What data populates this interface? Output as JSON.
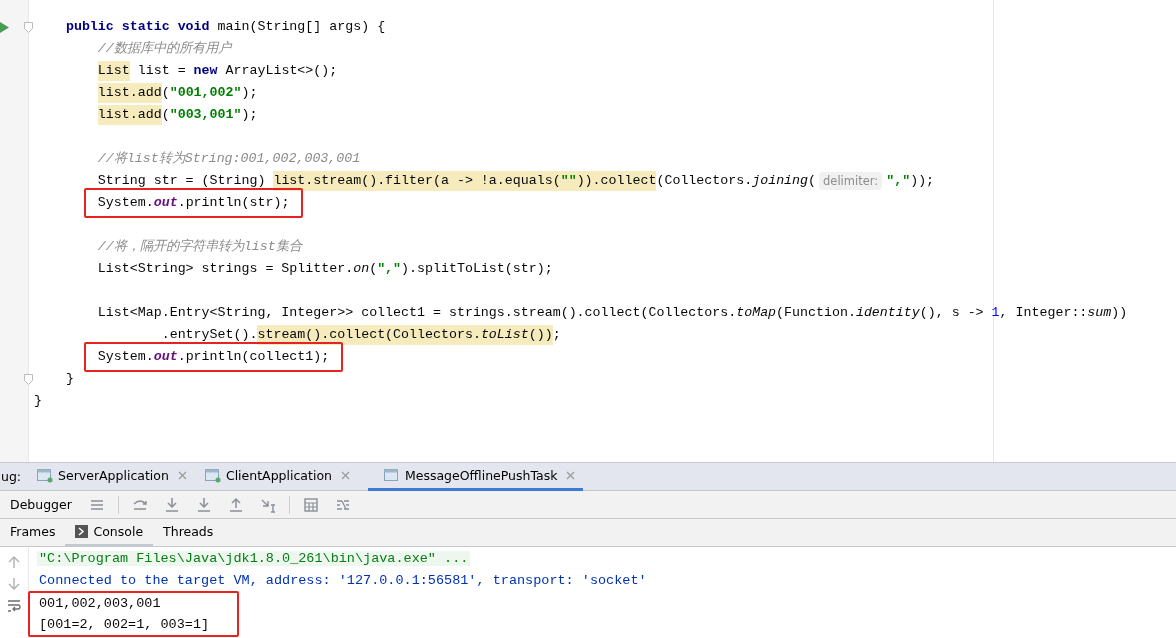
{
  "editor": {
    "lines": [
      {
        "boxed": false,
        "run_marker": true,
        "fold": true,
        "tokens": [
          {
            "text": "    public static void",
            "kind": "keyword",
            "hl": false
          },
          {
            "text": " main(String[] args) {",
            "kind": "plain",
            "hl": false
          }
        ]
      },
      {
        "boxed": false,
        "run_marker": false,
        "fold": false,
        "tokens": [
          {
            "text": "        //数据库中的所有用户",
            "kind": "comment",
            "hl": false
          }
        ]
      },
      {
        "boxed": false,
        "run_marker": false,
        "fold": false,
        "tokens": [
          {
            "text": "        List",
            "kind": "plain",
            "hl": true
          },
          {
            "text": " list = ",
            "kind": "plain",
            "hl": false
          },
          {
            "text": "new",
            "kind": "keyword",
            "hl": false
          },
          {
            "text": " ArrayList<>();",
            "kind": "plain",
            "hl": false
          }
        ]
      },
      {
        "boxed": false,
        "run_marker": false,
        "fold": false,
        "tokens": [
          {
            "text": "        list.add",
            "kind": "plain",
            "hl": true
          },
          {
            "text": "(",
            "kind": "plain",
            "hl": false
          },
          {
            "text": "\"001,002\"",
            "kind": "string",
            "hl": false
          },
          {
            "text": ");",
            "kind": "plain",
            "hl": false
          }
        ]
      },
      {
        "boxed": false,
        "run_marker": false,
        "fold": false,
        "tokens": [
          {
            "text": "        list.add",
            "kind": "plain",
            "hl": true
          },
          {
            "text": "(",
            "kind": "plain",
            "hl": false
          },
          {
            "text": "\"003,001\"",
            "kind": "string",
            "hl": false
          },
          {
            "text": ");",
            "kind": "plain",
            "hl": false
          }
        ]
      },
      {
        "boxed": false,
        "run_marker": false,
        "fold": false
      },
      {
        "boxed": false,
        "run_marker": false,
        "fold": false,
        "tokens": [
          {
            "text": "        //将list转为String:001,002,003,001",
            "kind": "comment",
            "hl": false
          }
        ]
      },
      {
        "boxed": false,
        "run_marker": false,
        "fold": false,
        "tokens": [
          {
            "text": "        String str = (String) ",
            "kind": "plain",
            "hl": false
          },
          {
            "text": "list.stream().filter(a -> !a.equals(",
            "kind": "plain",
            "hl": true
          },
          {
            "text": "\"\"",
            "kind": "string",
            "hl": true
          },
          {
            "text": ")).collect",
            "kind": "plain",
            "hl": true
          },
          {
            "text": "(Collectors.",
            "kind": "plain",
            "hl": false
          },
          {
            "text": "joining",
            "kind": "method",
            "hl": false
          },
          {
            "text": "(",
            "kind": "plain",
            "hl": false
          },
          {
            "text": "delimiter:",
            "kind": "hint",
            "hl": false
          },
          {
            "text": "\",\"",
            "kind": "string",
            "hl": false
          },
          {
            "text": "));",
            "kind": "plain",
            "hl": false
          }
        ]
      },
      {
        "boxed": true,
        "run_marker": false,
        "fold": false,
        "tokens": [
          {
            "text": "        System.",
            "kind": "plain",
            "hl": false
          },
          {
            "text": "out",
            "kind": "field",
            "hl": false
          },
          {
            "text": ".println(str);",
            "kind": "plain",
            "hl": false
          }
        ]
      },
      {
        "boxed": false,
        "run_marker": false,
        "fold": false
      },
      {
        "boxed": false,
        "run_marker": false,
        "fold": false,
        "tokens": [
          {
            "text": "        //将，隔开的字符串转为list集合",
            "kind": "comment",
            "hl": false
          }
        ]
      },
      {
        "boxed": false,
        "run_marker": false,
        "fold": false,
        "tokens": [
          {
            "text": "        List<String> strings = Splitter.",
            "kind": "plain",
            "hl": false
          },
          {
            "text": "on",
            "kind": "method",
            "hl": false
          },
          {
            "text": "(",
            "kind": "plain",
            "hl": false
          },
          {
            "text": "\",\"",
            "kind": "string",
            "hl": false
          },
          {
            "text": ").splitToList(str);",
            "kind": "plain",
            "hl": false
          }
        ]
      },
      {
        "boxed": false,
        "run_marker": false,
        "fold": false
      },
      {
        "boxed": false,
        "run_marker": false,
        "fold": false,
        "tokens": [
          {
            "text": "        List<Map.Entry<String, Integer>> collect1 = strings.stream().collect(Collectors.",
            "kind": "plain",
            "hl": false
          },
          {
            "text": "toMap",
            "kind": "method",
            "hl": false
          },
          {
            "text": "(Function.",
            "kind": "plain",
            "hl": false
          },
          {
            "text": "identity",
            "kind": "method",
            "hl": false
          },
          {
            "text": "(), s -> ",
            "kind": "plain",
            "hl": false
          },
          {
            "text": "1",
            "kind": "number",
            "hl": false
          },
          {
            "text": ", Integer::",
            "kind": "plain",
            "hl": false
          },
          {
            "text": "sum",
            "kind": "method",
            "hl": false
          },
          {
            "text": "))",
            "kind": "plain",
            "hl": false
          }
        ]
      },
      {
        "boxed": false,
        "run_marker": false,
        "fold": false,
        "tokens": [
          {
            "text": "                .entrySet().",
            "kind": "plain",
            "hl": false
          },
          {
            "text": "stream().collect(Collectors.",
            "kind": "plain",
            "hl": true
          },
          {
            "text": "toList",
            "kind": "method",
            "hl": true
          },
          {
            "text": "())",
            "kind": "plain",
            "hl": true
          },
          {
            "text": ";",
            "kind": "plain",
            "hl": false
          }
        ]
      },
      {
        "boxed": true,
        "run_marker": false,
        "fold": false,
        "tokens": [
          {
            "text": "        System.",
            "kind": "plain",
            "hl": false
          },
          {
            "text": "out",
            "kind": "field",
            "hl": false
          },
          {
            "text": ".println(collect1);",
            "kind": "plain",
            "hl": false
          }
        ]
      },
      {
        "boxed": false,
        "run_marker": false,
        "fold": true,
        "tokens": [
          {
            "text": "    }",
            "kind": "plain",
            "hl": false
          }
        ]
      },
      {
        "boxed": false,
        "run_marker": false,
        "fold": false,
        "tokens": [
          {
            "text": "}",
            "kind": "plain",
            "hl": false
          }
        ]
      }
    ]
  },
  "debug_panel": {
    "label": "ug:",
    "run_tabs": [
      {
        "label": "ServerApplication",
        "selected": false,
        "running": true
      },
      {
        "label": "ClientApplication",
        "selected": false,
        "running": true
      },
      {
        "label": "MessageOfflinePushTask",
        "selected": true,
        "running": false
      }
    ],
    "toolbar": {
      "label": "Debugger"
    },
    "view_tabs": [
      {
        "label": "Frames",
        "selected": false,
        "kind": "text"
      },
      {
        "label": "Console",
        "selected": true,
        "kind": "console"
      },
      {
        "label": "Threads",
        "selected": false,
        "kind": "text"
      }
    ],
    "console": {
      "lines": [
        {
          "text": "\"C:\\Program Files\\Java\\jdk1.8.0_261\\bin\\java.exe\" ...",
          "kind": "command",
          "boxed": false
        },
        {
          "text": "Connected to the target VM, address: '127.0.0.1:56581', transport: 'socket'",
          "kind": "info",
          "boxed": false
        },
        {
          "text": "001,002,003,001",
          "kind": "output",
          "boxed": true
        },
        {
          "text": "[001=2, 002=1, 003=1]",
          "kind": "output",
          "boxed": true
        }
      ]
    }
  }
}
